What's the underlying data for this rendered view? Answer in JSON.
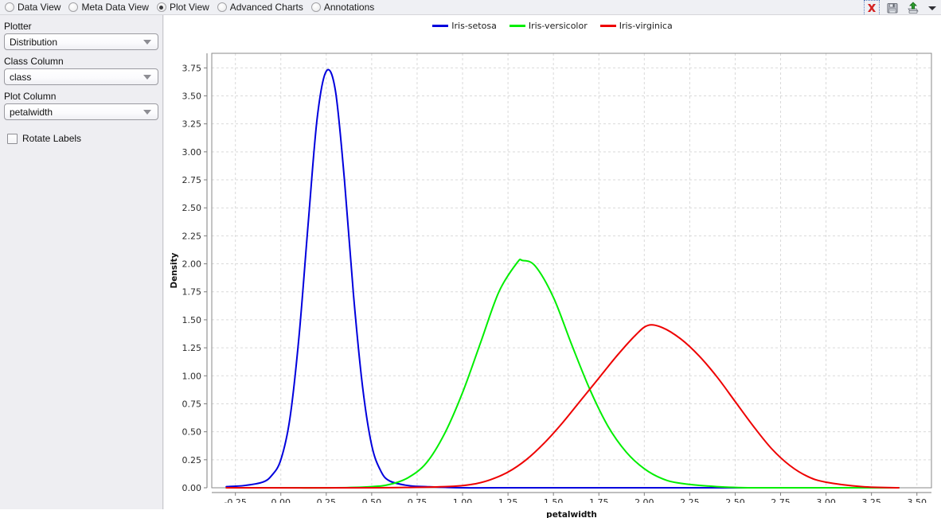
{
  "topbar": {
    "views": [
      {
        "label": "Data View",
        "selected": false
      },
      {
        "label": "Meta Data View",
        "selected": false
      },
      {
        "label": "Plot View",
        "selected": true
      },
      {
        "label": "Advanced Charts",
        "selected": false
      },
      {
        "label": "Annotations",
        "selected": false
      }
    ],
    "tools": [
      {
        "name": "delete-icon",
        "title": "Clear"
      },
      {
        "name": "save-icon",
        "title": "Save"
      },
      {
        "name": "export-icon",
        "title": "Export"
      },
      {
        "name": "chevron-down-icon",
        "title": "More"
      }
    ]
  },
  "sidebar": {
    "plotter_label": "Plotter",
    "plotter_value": "Distribution",
    "class_column_label": "Class Column",
    "class_column_value": "class",
    "plot_column_label": "Plot Column",
    "plot_column_value": "petalwidth",
    "rotate_labels_label": "Rotate Labels",
    "rotate_labels_checked": false
  },
  "chart_data": {
    "type": "line",
    "title": "",
    "xlabel": "petalwidth",
    "ylabel": "Density",
    "xlim": [
      -0.38,
      3.58
    ],
    "ylim": [
      0.0,
      3.88
    ],
    "grid": true,
    "legend_position": "top-center",
    "xticks": [
      -0.25,
      0.0,
      0.25,
      0.5,
      0.75,
      1.0,
      1.25,
      1.5,
      1.75,
      2.0,
      2.25,
      2.5,
      2.75,
      3.0,
      3.25,
      3.5
    ],
    "xtick_labels": [
      "-0.25",
      "0.00",
      "0.25",
      "0.50",
      "0.75",
      "1.00",
      "1.25",
      "1.50",
      "1.75",
      "2.00",
      "2.25",
      "2.50",
      "2.75",
      "3.00",
      "3.25",
      "3.50"
    ],
    "yticks": [
      0.0,
      0.25,
      0.5,
      0.75,
      1.0,
      1.25,
      1.5,
      1.75,
      2.0,
      2.25,
      2.5,
      2.75,
      3.0,
      3.25,
      3.5,
      3.75
    ],
    "ytick_labels": [
      "0.00",
      "0.25",
      "0.50",
      "0.75",
      "1.00",
      "1.25",
      "1.50",
      "1.75",
      "2.00",
      "2.25",
      "2.50",
      "2.75",
      "3.00",
      "3.25",
      "3.50",
      "3.75"
    ],
    "series": [
      {
        "name": "Iris-setosa",
        "color": "#0000dd",
        "kind": "kernel-density",
        "peak_x": 0.25,
        "peak_y": 3.72,
        "x": [
          -0.3,
          -0.2,
          -0.1,
          -0.05,
          0.0,
          0.05,
          0.1,
          0.15,
          0.2,
          0.25,
          0.3,
          0.35,
          0.4,
          0.45,
          0.5,
          0.55,
          0.6,
          0.7,
          0.8,
          1.0,
          1.3,
          1.6,
          2.0,
          2.5,
          3.0,
          3.4
        ],
        "y": [
          0.01,
          0.02,
          0.05,
          0.11,
          0.25,
          0.62,
          1.35,
          2.35,
          3.3,
          3.72,
          3.55,
          2.75,
          1.72,
          0.9,
          0.38,
          0.15,
          0.06,
          0.02,
          0.01,
          0.0,
          0.0,
          0.0,
          0.0,
          0.0,
          0.0,
          0.0
        ]
      },
      {
        "name": "Iris-versicolor",
        "color": "#00ee00",
        "kind": "kernel-density",
        "peak_x": 1.33,
        "peak_y": 2.03,
        "x": [
          -0.3,
          0.0,
          0.3,
          0.5,
          0.6,
          0.7,
          0.8,
          0.9,
          1.0,
          1.1,
          1.2,
          1.3,
          1.33,
          1.4,
          1.5,
          1.6,
          1.7,
          1.8,
          1.9,
          2.0,
          2.1,
          2.2,
          2.4,
          2.6,
          3.0,
          3.4
        ],
        "y": [
          0.0,
          0.0,
          0.0,
          0.01,
          0.03,
          0.09,
          0.22,
          0.48,
          0.85,
          1.3,
          1.75,
          2.01,
          2.03,
          1.98,
          1.7,
          1.28,
          0.88,
          0.55,
          0.32,
          0.17,
          0.08,
          0.04,
          0.01,
          0.0,
          0.0,
          0.0
        ]
      },
      {
        "name": "Iris-virginica",
        "color": "#ee0000",
        "kind": "kernel-density",
        "peak_x": 2.02,
        "peak_y": 1.45,
        "x": [
          -0.3,
          0.5,
          0.9,
          1.05,
          1.15,
          1.25,
          1.35,
          1.45,
          1.55,
          1.65,
          1.75,
          1.85,
          1.95,
          2.02,
          2.1,
          2.2,
          2.3,
          2.4,
          2.5,
          2.6,
          2.7,
          2.8,
          2.9,
          3.0,
          3.2,
          3.4
        ],
        "y": [
          0.0,
          0.0,
          0.01,
          0.03,
          0.07,
          0.14,
          0.25,
          0.4,
          0.58,
          0.78,
          0.98,
          1.18,
          1.36,
          1.45,
          1.43,
          1.33,
          1.18,
          0.99,
          0.77,
          0.55,
          0.35,
          0.2,
          0.1,
          0.05,
          0.01,
          0.0
        ]
      }
    ]
  }
}
